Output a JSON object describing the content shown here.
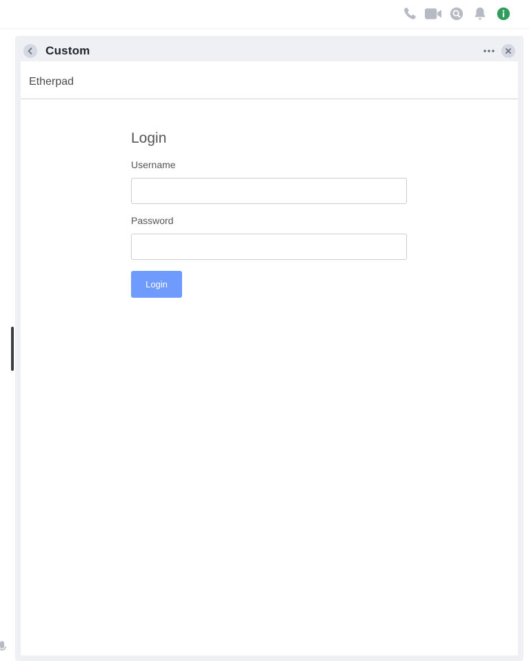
{
  "topbar": {
    "icons": [
      "phone-icon",
      "video-icon",
      "search-icon",
      "bell-icon",
      "info-icon"
    ],
    "info_color": "#2e9e5b",
    "icon_color": "#b5bac3"
  },
  "panel": {
    "title": "Custom",
    "icons": [
      "chevron-left-icon",
      "more-horizontal-icon",
      "close-icon"
    ]
  },
  "frame": {
    "brand": "Etherpad",
    "login": {
      "title": "Login",
      "username_label": "Username",
      "username_value": "",
      "password_label": "Password",
      "password_value": "",
      "submit_label": "Login",
      "submit_color": "#6f9bff"
    }
  }
}
